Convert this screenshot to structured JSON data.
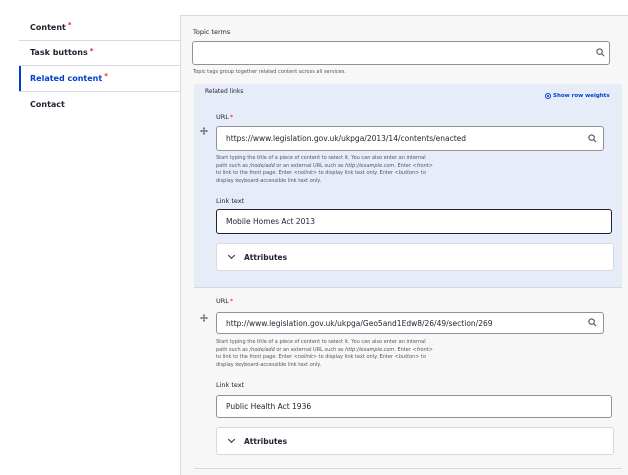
{
  "tabs": [
    {
      "label": "Content",
      "required": "*"
    },
    {
      "label": "Task buttons",
      "required": "*"
    },
    {
      "label": "Related content",
      "required": "*"
    },
    {
      "label": "Contact",
      "required": ""
    }
  ],
  "topic": {
    "label": "Topic terms",
    "value": "",
    "description": "Topic tags group together related content across all services."
  },
  "related": {
    "label": "Related links",
    "row_weights": "Show row weights",
    "items": [
      {
        "url_label": "URL",
        "url_req": "*",
        "url_value": "https://www.legislation.gov.uk/ukpga/2013/14/contents/enacted",
        "desc_1": "Start typing the title of a piece of content to select it. You can also enter an internal",
        "desc_2a": "path such as ",
        "desc_2b": "/node/add",
        "desc_2c": " or an external URL such as ",
        "desc_2d": "http://example.com",
        "desc_2e": ". Enter ",
        "desc_2f": "<front>",
        "desc_3a": "to link to the front page. Enter ",
        "desc_3b": "<nolink>",
        "desc_3c": " to display link text only. Enter ",
        "desc_3d": "<button>",
        "desc_3e": " to",
        "desc_4": "display keyboard-accessible link text only.",
        "text_label": "Link text",
        "text_value": "Mobile Homes Act 2013",
        "attributes": "Attributes"
      },
      {
        "url_label": "URL",
        "url_req": "*",
        "url_value": "http://www.legislation.gov.uk/ukpga/Geo5and1Edw8/26/49/section/269",
        "desc_1": "Start typing the title of a piece of content to select it. You can also enter an internal",
        "desc_2a": "path such as ",
        "desc_2b": "/node/add",
        "desc_2c": " or an external URL such as ",
        "desc_2d": "http://example.com",
        "desc_2e": ". Enter ",
        "desc_2f": "<front>",
        "desc_3a": "to link to the front page. Enter ",
        "desc_3b": "<nolink>",
        "desc_3c": " to display link text only. Enter ",
        "desc_3d": "<button>",
        "desc_3e": " to",
        "desc_4": "display keyboard-accessible link text only.",
        "text_label": "Link text",
        "text_value": "Public Health Act 1936",
        "attributes": "Attributes"
      }
    ]
  },
  "icons": {
    "search": "search-icon",
    "drag": "drag-handle-icon",
    "chevron": "chevron-down-icon"
  },
  "colors": {
    "accent": "#003ecc",
    "required": "#d72222",
    "selected_row": "#e6ecf8"
  }
}
